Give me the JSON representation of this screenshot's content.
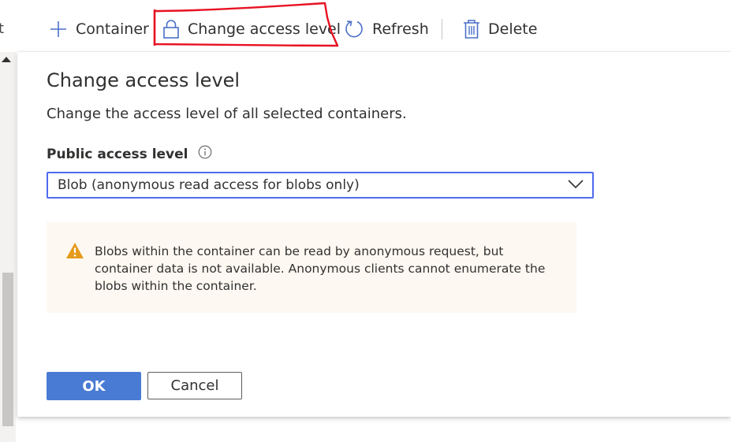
{
  "toolbar": {
    "container_label": "Container",
    "change_access_label": "Change access level",
    "refresh_label": "Refresh",
    "delete_label": "Delete",
    "left_edge_glyph": "t"
  },
  "dialog": {
    "title": "Change access level",
    "description": "Change the access level of all selected containers.",
    "field_label": "Public access level",
    "selected_value": "Blob (anonymous read access for blobs only)",
    "warning_text": "Blobs within the container can be read by anonymous request, but container data is not available. Anonymous clients cannot enumerate the blobs within the container.",
    "ok_label": "OK",
    "cancel_label": "Cancel"
  },
  "icons": {
    "container": "plus-icon",
    "change_access": "lock-icon",
    "refresh": "refresh-icon",
    "delete": "trash-icon",
    "info": "info-icon",
    "warning": "warning-icon",
    "dropdown": "chevron-down-icon"
  },
  "colors": {
    "accent": "#4a7bd4",
    "select_border": "#4f6bed",
    "warning_bg": "#fdf8f1",
    "warning_icon": "#e59a1c",
    "annotation": "#e81123"
  }
}
